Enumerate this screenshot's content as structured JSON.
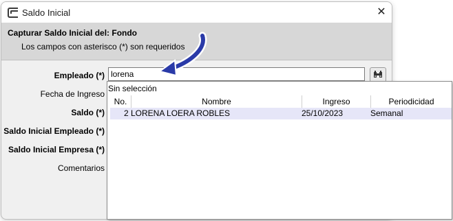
{
  "window": {
    "title": "Saldo Inicial",
    "close_glyph": "✕"
  },
  "header": {
    "title": "Capturar Saldo Inicial del: Fondo",
    "subtitle": "Los campos con asterisco (*) son requeridos"
  },
  "form": {
    "empleado_label": "Empleado (*)",
    "empleado_value": "lorena",
    "fecha_label": "Fecha de Ingreso",
    "saldo_label": "Saldo (*)",
    "saldo_empleado_label": "Saldo Inicial Empleado (*)",
    "saldo_empresa_label": "Saldo Inicial Empresa (*)",
    "comentarios_label": "Comentarios"
  },
  "dropdown": {
    "none_option": "Sin selección",
    "columns": [
      "No.",
      "Nombre",
      "Ingreso",
      "Periodicidad"
    ],
    "rows": [
      {
        "no": "2",
        "nombre": "LORENA LOERA ROBLES",
        "ingreso": "25/10/2023",
        "periodicidad": "Semanal"
      }
    ]
  },
  "icons": {
    "app": "app-window-icon",
    "lookup": "binoculars-icon",
    "annotation": "pointer-arrow-icon"
  },
  "colors": {
    "header_bg": "#d7d7d7",
    "row_highlight": "#e6e6f8",
    "arrow_blue": "#2a3aa8"
  }
}
